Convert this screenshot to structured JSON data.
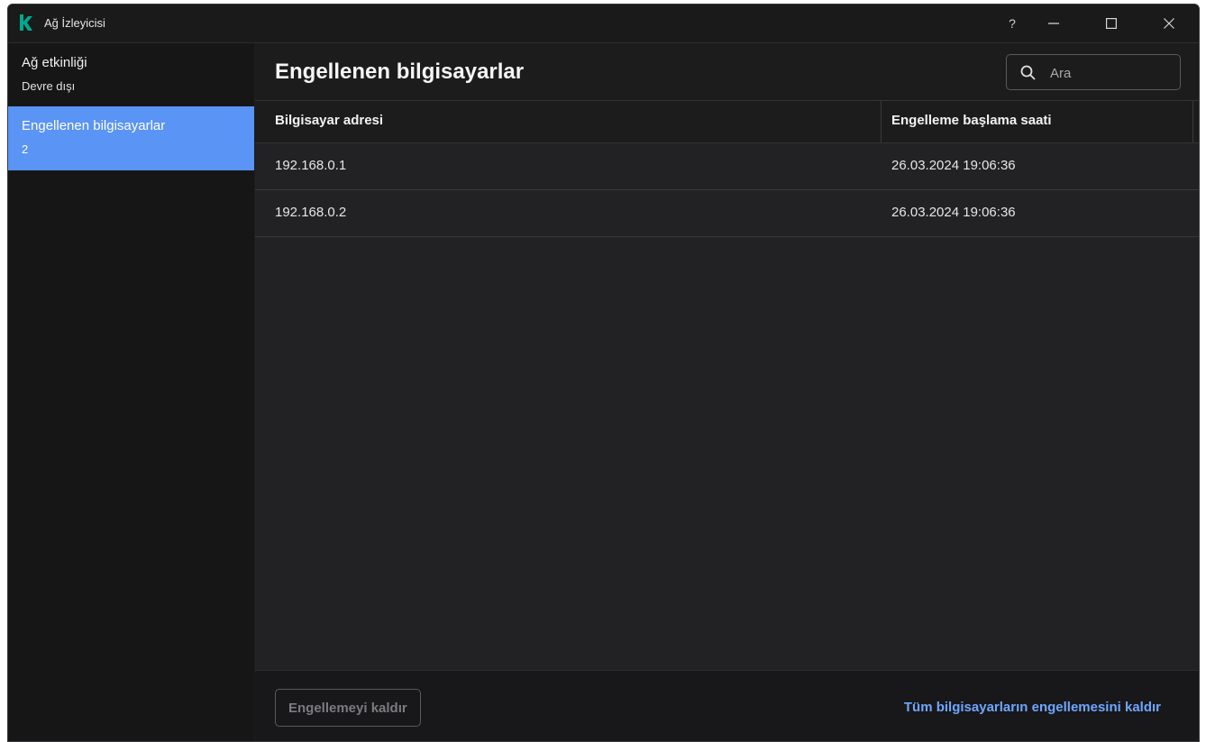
{
  "window": {
    "title": "Ağ İzleyicisi",
    "help_label": "?",
    "accent_color": "#5a94f5",
    "logo_color": "#00a88e"
  },
  "sidebar": {
    "items": [
      {
        "label": "Ağ etkinliği",
        "sublabel": "Devre dışı",
        "active": false
      },
      {
        "label": "Engellenen bilgisayarlar",
        "sublabel": "2",
        "active": true
      }
    ]
  },
  "main": {
    "title": "Engellenen bilgisayarlar",
    "search": {
      "placeholder": "Ara",
      "value": ""
    },
    "table": {
      "columns": [
        "Bilgisayar adresi",
        "Engelleme başlama saati"
      ],
      "rows": [
        {
          "address": "192.168.0.1",
          "time": "26.03.2024 19:06:36"
        },
        {
          "address": "192.168.0.2",
          "time": "26.03.2024 19:06:36"
        }
      ]
    },
    "footer": {
      "unblock_label": "Engellemeyi kaldır",
      "unblock_all_label": "Tüm bilgisayarların engellemesini kaldır"
    }
  }
}
